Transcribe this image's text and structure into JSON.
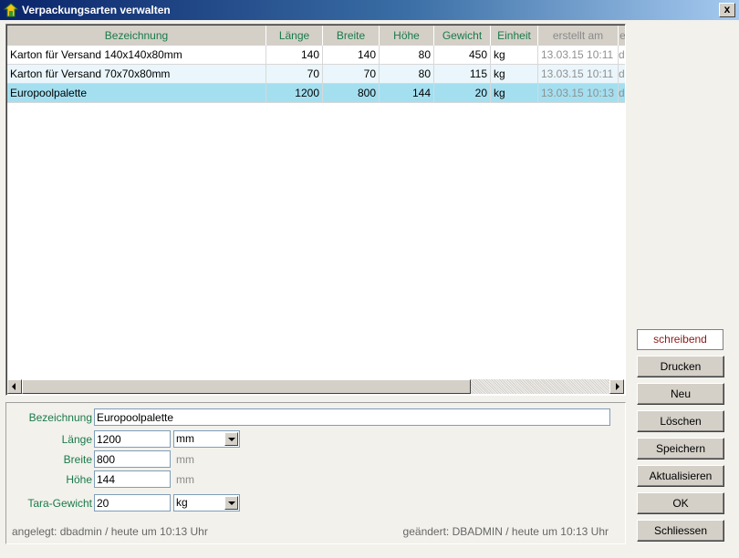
{
  "window": {
    "title": "Verpackungsarten verwalten",
    "close_label": "x"
  },
  "grid": {
    "columns": [
      "Bezeichnung",
      "Länge",
      "Breite",
      "Höhe",
      "Gewicht",
      "Einheit",
      "erstellt am",
      "e"
    ],
    "rows": [
      {
        "bezeichnung": "Karton für Versand 140x140x80mm",
        "laenge": "140",
        "breite": "140",
        "hoehe": "80",
        "gewicht": "450",
        "einheit": "kg",
        "erstellt": "13.03.15 10:11",
        "e": "d"
      },
      {
        "bezeichnung": "Karton für Versand 70x70x80mm",
        "laenge": "70",
        "breite": "70",
        "hoehe": "80",
        "gewicht": "115",
        "einheit": "kg",
        "erstellt": "13.03.15 10:11",
        "e": "d"
      },
      {
        "bezeichnung": "Europoolpalette",
        "laenge": "1200",
        "breite": "800",
        "hoehe": "144",
        "gewicht": "20",
        "einheit": "kg",
        "erstellt": "13.03.15 10:13",
        "e": "d"
      }
    ],
    "selected_row": 2
  },
  "form": {
    "bezeichnung_label": "Bezeichnung",
    "bezeichnung_value": "Europoolpalette",
    "laenge_label": "Länge",
    "laenge_value": "1200",
    "laenge_unit": "mm",
    "breite_label": "Breite",
    "breite_value": "800",
    "breite_unit": "mm",
    "hoehe_label": "Höhe",
    "hoehe_value": "144",
    "hoehe_unit": "mm",
    "tara_label": "Tara-Gewicht",
    "tara_value": "20",
    "tara_unit": "kg",
    "angelegt": "angelegt: dbadmin / heute um 10:13 Uhr",
    "geaendert": "geändert: DBADMIN / heute um 10:13 Uhr"
  },
  "sidebar": {
    "status": "schreibend",
    "buttons": {
      "drucken": "Drucken",
      "neu": "Neu",
      "loeschen": "Löschen",
      "speichern": "Speichern",
      "aktualisieren": "Aktualisieren",
      "ok": "OK",
      "schliessen": "Schliessen"
    }
  },
  "colors": {
    "header_text": "#1a7a4a",
    "selected_row": "#a4dff0",
    "alt_row": "#eaf6fb",
    "status_text": "#8b1a1a"
  }
}
